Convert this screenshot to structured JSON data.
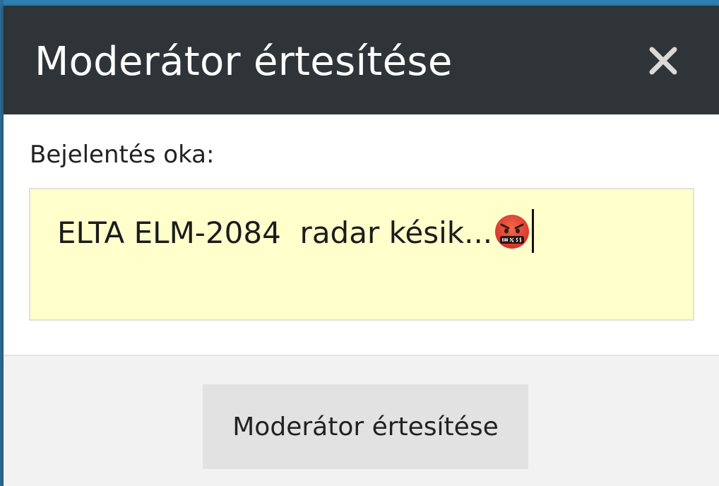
{
  "dialog": {
    "title": "Moderátor értesítése",
    "close_icon": "close-icon"
  },
  "form": {
    "reason_label": "Bejelentés oka:",
    "reason_value": "ELTA ELM-2084  radar késik...",
    "reason_emoji": "face-with-symbols-on-mouth-icon"
  },
  "footer": {
    "submit_label": "Moderátor értesítése"
  },
  "colors": {
    "backdrop": "#2c7fb0",
    "header_bg": "#2e3438",
    "textarea_bg": "#ffffcc",
    "footer_bg": "#f2f2f2",
    "button_bg": "#e2e2e2",
    "close_icon": "#d9d9d9"
  }
}
